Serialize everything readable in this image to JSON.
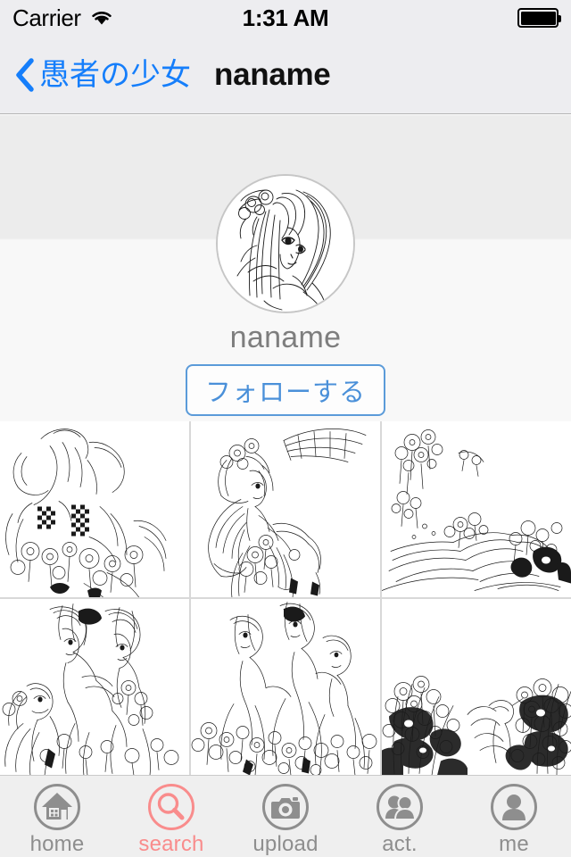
{
  "status_bar": {
    "carrier": "Carrier",
    "wifi_icon": "wifi-icon",
    "time": "1:31 AM",
    "battery_icon": "battery-full-icon",
    "battery_level_percent": 100
  },
  "nav_bar": {
    "back_icon": "chevron-left-icon",
    "back_label": "愚者の少女",
    "title": "naname"
  },
  "profile": {
    "avatar_alt": "avatar",
    "username": "naname",
    "follow_button_label": "フォローする",
    "follow_button_color": "#4A90D9",
    "follow_button_border_color": "#5B9BD9",
    "username_color": "#7E7E7E"
  },
  "gallery": {
    "columns": 3,
    "rows": 2,
    "items": [
      {
        "id": "artwork-1",
        "caption": "fairy in ruffled dress with checkered bows and flowers"
      },
      {
        "id": "artwork-2",
        "caption": "winged fairy seated among blossoms"
      },
      {
        "id": "artwork-3",
        "caption": "reclining figure with floral sprays"
      },
      {
        "id": "artwork-4",
        "caption": "group of figures with winged child"
      },
      {
        "id": "artwork-5",
        "caption": "three figures in flowering field"
      },
      {
        "id": "artwork-6",
        "caption": "dense floral landscape with bird"
      }
    ]
  },
  "tab_bar": {
    "active_index": 1,
    "active_color": "#F98C8C",
    "inactive_color": "#8E8E8E",
    "items": [
      {
        "label": "home",
        "icon": "home-icon"
      },
      {
        "label": "search",
        "icon": "search-icon"
      },
      {
        "label": "upload",
        "icon": "camera-icon"
      },
      {
        "label": "act.",
        "icon": "people-icon"
      },
      {
        "label": "me",
        "icon": "person-icon"
      }
    ]
  }
}
